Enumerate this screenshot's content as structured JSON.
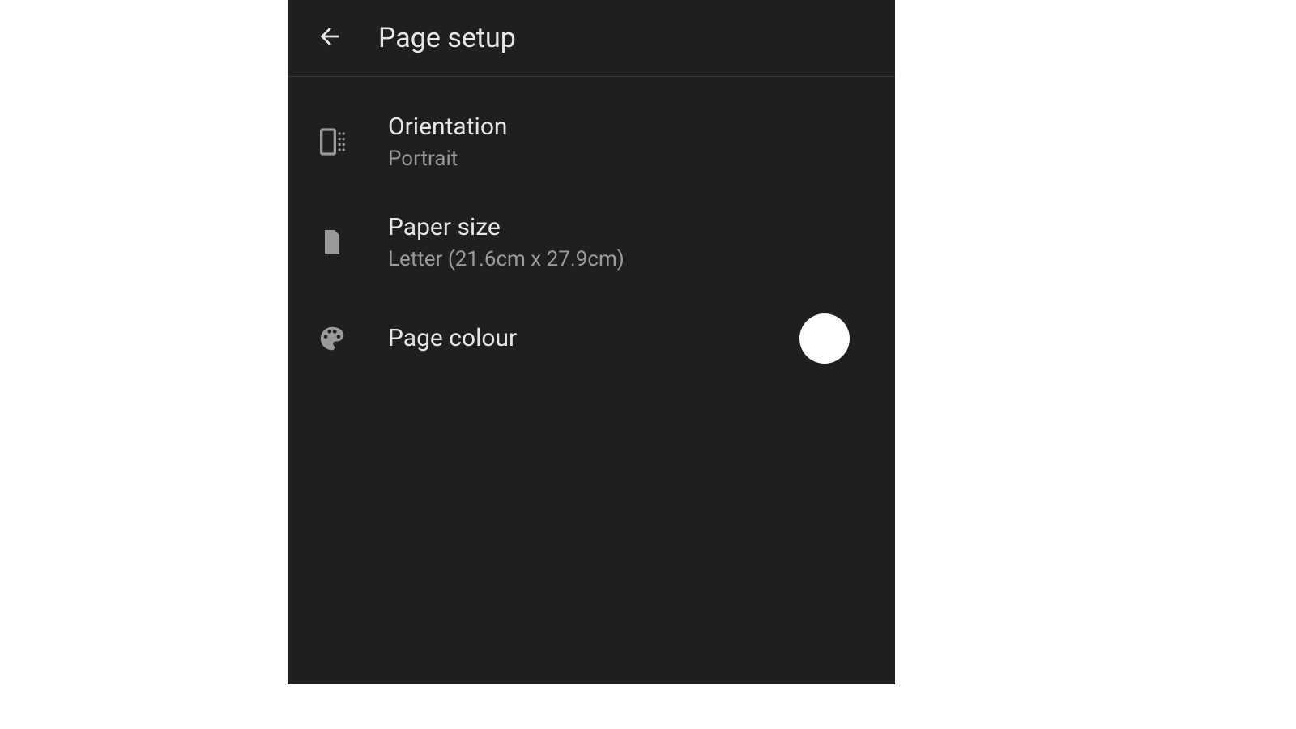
{
  "header": {
    "title": "Page setup"
  },
  "items": {
    "orientation": {
      "title": "Orientation",
      "value": "Portrait"
    },
    "paper_size": {
      "title": "Paper size",
      "value": "Letter (21.6cm x 27.9cm)"
    },
    "page_colour": {
      "title": "Page colour",
      "swatch_color": "#ffffff"
    }
  }
}
